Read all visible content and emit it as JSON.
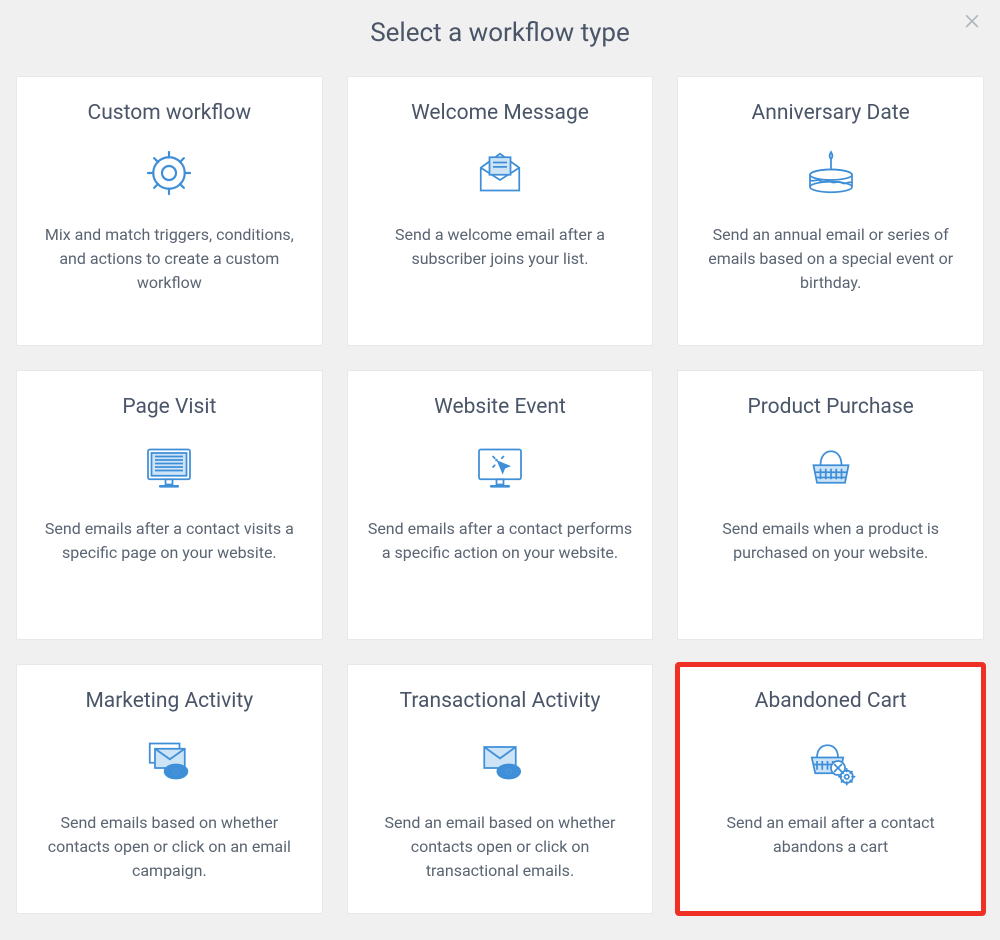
{
  "modal": {
    "title": "Select a workflow type"
  },
  "cards": [
    {
      "title": "Custom workflow",
      "desc": "Mix and match triggers, conditions, and actions to create a custom workflow",
      "icon": "gear-icon",
      "highlight": false
    },
    {
      "title": "Welcome Message",
      "desc": "Send a welcome email after a subscriber joins your list.",
      "icon": "envelope-open-icon",
      "highlight": false
    },
    {
      "title": "Anniversary Date",
      "desc": "Send an annual email or series of emails based on a special event or birthday.",
      "icon": "cake-icon",
      "highlight": false
    },
    {
      "title": "Page Visit",
      "desc": "Send emails after a contact visits a specific page on your website.",
      "icon": "monitor-lines-icon",
      "highlight": false
    },
    {
      "title": "Website Event",
      "desc": "Send emails after a contact performs a specific action on your website.",
      "icon": "monitor-click-icon",
      "highlight": false
    },
    {
      "title": "Product Purchase",
      "desc": "Send emails when a product is purchased on your website.",
      "icon": "basket-icon",
      "highlight": false
    },
    {
      "title": "Marketing Activity",
      "desc": "Send emails based on whether contacts open or click on an email campaign.",
      "icon": "mail-eye-icon",
      "highlight": false
    },
    {
      "title": "Transactional Activity",
      "desc": "Send an email based on whether contacts open or click on transactional emails.",
      "icon": "mail-eye-single-icon",
      "highlight": false
    },
    {
      "title": "Abandoned Cart",
      "desc": "Send an email after a contact abandons a cart",
      "icon": "basket-gear-icon",
      "highlight": true
    }
  ],
  "colors": {
    "iconFill": "#7fb6e6",
    "iconStroke": "#3f8fd8",
    "highlight": "#ef3024"
  }
}
